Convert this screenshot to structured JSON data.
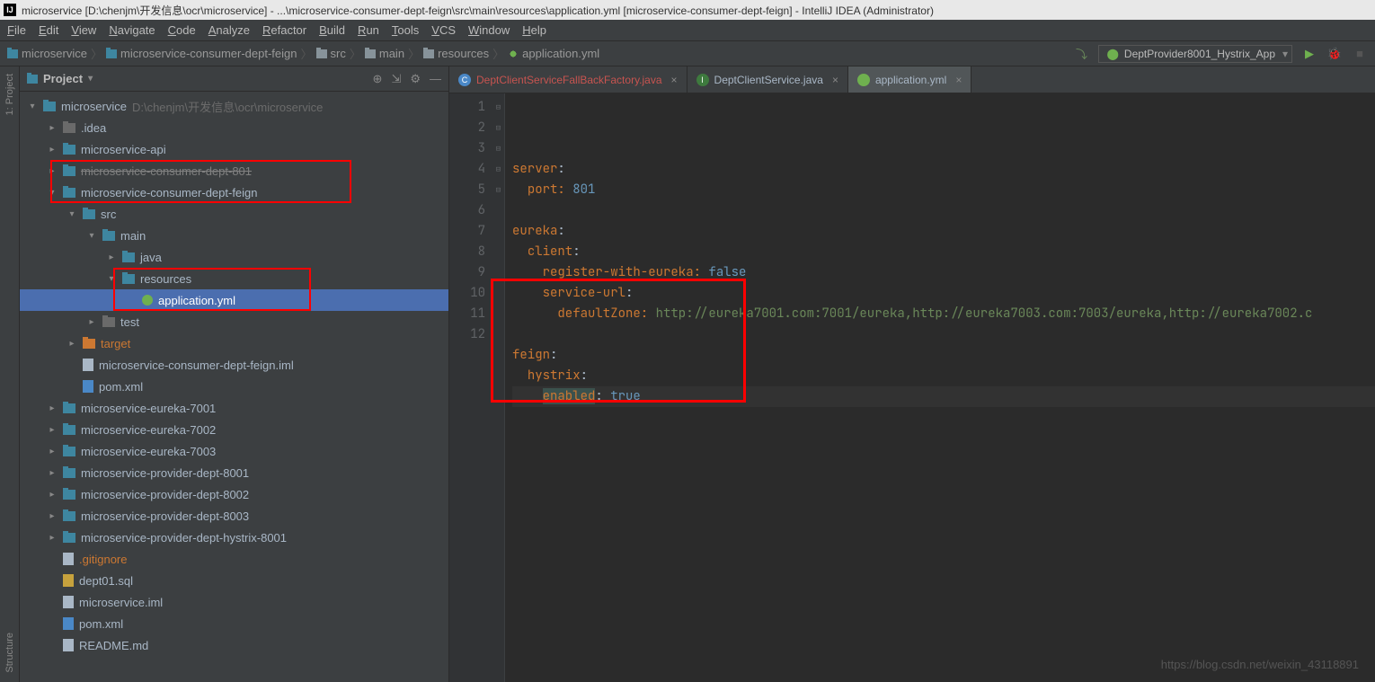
{
  "window": {
    "title": "microservice [D:\\chenjm\\开发信息\\ocr\\microservice] - ...\\microservice-consumer-dept-feign\\src\\main\\resources\\application.yml [microservice-consumer-dept-feign] - IntelliJ IDEA (Administrator)"
  },
  "menu": [
    "File",
    "Edit",
    "View",
    "Navigate",
    "Code",
    "Analyze",
    "Refactor",
    "Build",
    "Run",
    "Tools",
    "VCS",
    "Window",
    "Help"
  ],
  "breadcrumbs": [
    "microservice",
    "microservice-consumer-dept-feign",
    "src",
    "main",
    "resources",
    "application.yml"
  ],
  "run_config": "DeptProvider8001_Hystrix_App",
  "panel": {
    "title": "Project"
  },
  "sidebar_labels": {
    "project": "1: Project",
    "structure": "Structure"
  },
  "tree": [
    {
      "depth": 0,
      "arrow": "open",
      "icon": "folder-blue",
      "label": "microservice",
      "suffix": "D:\\chenjm\\开发信息\\ocr\\microservice"
    },
    {
      "depth": 1,
      "arrow": "closed",
      "icon": "folder-dark",
      "label": ".idea"
    },
    {
      "depth": 1,
      "arrow": "closed",
      "icon": "folder-blue",
      "label": "microservice-api"
    },
    {
      "depth": 1,
      "arrow": "closed",
      "icon": "folder-blue",
      "label": "microservice-consumer-dept-801",
      "strike": true
    },
    {
      "depth": 1,
      "arrow": "open",
      "icon": "folder-blue",
      "label": "microservice-consumer-dept-feign"
    },
    {
      "depth": 2,
      "arrow": "open",
      "icon": "folder-blue",
      "label": "src"
    },
    {
      "depth": 3,
      "arrow": "open",
      "icon": "folder-blue",
      "label": "main"
    },
    {
      "depth": 4,
      "arrow": "closed",
      "icon": "folder-blue",
      "label": "java"
    },
    {
      "depth": 4,
      "arrow": "open",
      "icon": "folder-blue",
      "label": "resources"
    },
    {
      "depth": 5,
      "arrow": "none",
      "icon": "file-yml",
      "label": "application.yml",
      "selected": true
    },
    {
      "depth": 3,
      "arrow": "closed",
      "icon": "folder-dark",
      "label": "test"
    },
    {
      "depth": 2,
      "arrow": "closed",
      "icon": "folder-orange",
      "label": "target",
      "orange": true
    },
    {
      "depth": 2,
      "arrow": "none",
      "icon": "file",
      "label": "microservice-consumer-dept-feign.iml"
    },
    {
      "depth": 2,
      "arrow": "none",
      "icon": "file-m",
      "label": "pom.xml"
    },
    {
      "depth": 1,
      "arrow": "closed",
      "icon": "folder-blue",
      "label": "microservice-eureka-7001"
    },
    {
      "depth": 1,
      "arrow": "closed",
      "icon": "folder-blue",
      "label": "microservice-eureka-7002"
    },
    {
      "depth": 1,
      "arrow": "closed",
      "icon": "folder-blue",
      "label": "microservice-eureka-7003"
    },
    {
      "depth": 1,
      "arrow": "closed",
      "icon": "folder-blue",
      "label": "microservice-provider-dept-8001"
    },
    {
      "depth": 1,
      "arrow": "closed",
      "icon": "folder-blue",
      "label": "microservice-provider-dept-8002"
    },
    {
      "depth": 1,
      "arrow": "closed",
      "icon": "folder-blue",
      "label": "microservice-provider-dept-8003"
    },
    {
      "depth": 1,
      "arrow": "closed",
      "icon": "folder-blue",
      "label": "microservice-provider-dept-hystrix-8001"
    },
    {
      "depth": 1,
      "arrow": "none",
      "icon": "file",
      "label": ".gitignore",
      "orange": true
    },
    {
      "depth": 1,
      "arrow": "none",
      "icon": "file-sql",
      "label": "dept01.sql"
    },
    {
      "depth": 1,
      "arrow": "none",
      "icon": "file",
      "label": "microservice.iml"
    },
    {
      "depth": 1,
      "arrow": "none",
      "icon": "file-m",
      "label": "pom.xml"
    },
    {
      "depth": 1,
      "arrow": "none",
      "icon": "file",
      "label": "README.md"
    }
  ],
  "tabs": [
    {
      "icon": "C",
      "label": "DeptClientServiceFallBackFactory.java",
      "red": true
    },
    {
      "icon": "I",
      "label": "DeptClientService.java"
    },
    {
      "icon": "Y",
      "label": "application.yml",
      "active": true
    }
  ],
  "code": {
    "lines": [
      {
        "n": 1,
        "seg": [
          {
            "t": "server",
            "c": "k-org"
          },
          {
            "t": ":",
            "c": ""
          }
        ]
      },
      {
        "n": 2,
        "seg": [
          {
            "t": "  ",
            "c": ""
          },
          {
            "t": "port: ",
            "c": "k-org"
          },
          {
            "t": "801",
            "c": "k-blue"
          }
        ]
      },
      {
        "n": 3,
        "seg": []
      },
      {
        "n": 4,
        "seg": [
          {
            "t": "eureka",
            "c": "k-org"
          },
          {
            "t": ":",
            "c": ""
          }
        ]
      },
      {
        "n": 5,
        "seg": [
          {
            "t": "  ",
            "c": ""
          },
          {
            "t": "client",
            "c": "k-org"
          },
          {
            "t": ":",
            "c": ""
          }
        ]
      },
      {
        "n": 6,
        "seg": [
          {
            "t": "    ",
            "c": ""
          },
          {
            "t": "register-with-eureka: ",
            "c": "k-org"
          },
          {
            "t": "false",
            "c": "k-blue"
          }
        ]
      },
      {
        "n": 7,
        "seg": [
          {
            "t": "    ",
            "c": ""
          },
          {
            "t": "service-url",
            "c": "k-org"
          },
          {
            "t": ":",
            "c": ""
          }
        ]
      },
      {
        "n": 8,
        "seg": [
          {
            "t": "      ",
            "c": ""
          },
          {
            "t": "defaultZone: ",
            "c": "k-org"
          },
          {
            "t": "http://eureka7001.com:7001/eureka,http://eureka7003.com:7003/eureka,http://eureka7002.c",
            "c": "k-grn"
          }
        ]
      },
      {
        "n": 9,
        "seg": []
      },
      {
        "n": 10,
        "seg": [
          {
            "t": "feign",
            "c": "k-org"
          },
          {
            "t": ":",
            "c": ""
          }
        ]
      },
      {
        "n": 11,
        "seg": [
          {
            "t": "  ",
            "c": ""
          },
          {
            "t": "hystrix",
            "c": "k-org"
          },
          {
            "t": ":",
            "c": ""
          }
        ]
      },
      {
        "n": 12,
        "current": true,
        "seg": [
          {
            "t": "    ",
            "c": ""
          },
          {
            "t": "enabled",
            "c": "k-org hl"
          },
          {
            "t": ": ",
            "c": ""
          },
          {
            "t": "true",
            "c": "k-blue"
          }
        ]
      }
    ]
  },
  "watermark": "https://blog.csdn.net/weixin_43118891"
}
